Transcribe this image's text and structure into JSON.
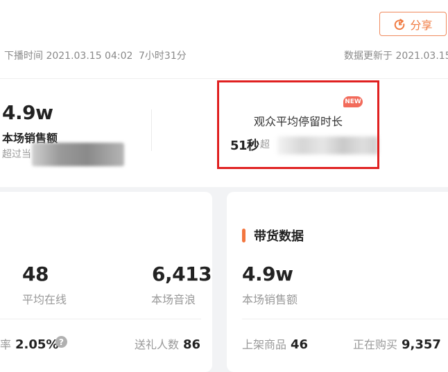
{
  "header": {
    "share_label": "分享",
    "broadcast_end": "下播时间 2021.03.15 04:02",
    "duration": "7小时31分",
    "data_updated": "数据更新于 2021.03.15"
  },
  "summary": {
    "sales": {
      "value": "4.9w",
      "label": "本场销售额",
      "sub": "超过当"
    },
    "avg_stay": {
      "badge": "NEW",
      "label": "观众平均停留时长",
      "value": "51秒",
      "sub": "超"
    }
  },
  "left_card": {
    "metrics": [
      {
        "value": "48",
        "label": "平均在线"
      },
      {
        "value": "6,413",
        "label": "本场音浪"
      }
    ],
    "stats": [
      {
        "label": "率",
        "value": "2.05%"
      },
      {
        "label": "送礼人数",
        "value": "86"
      }
    ]
  },
  "right_card": {
    "title": "带货数据",
    "metric": {
      "value": "4.9w",
      "label": "本场销售额"
    },
    "stats": [
      {
        "label": "上架商品",
        "value": "46"
      },
      {
        "label": "正在购买",
        "value": "9,357"
      }
    ]
  },
  "colors": {
    "accent": "#f3763f",
    "highlight": "#e02020",
    "badge": "#f26a5a"
  },
  "icons": {
    "share": "share-icon",
    "help": "question-circle-icon"
  }
}
